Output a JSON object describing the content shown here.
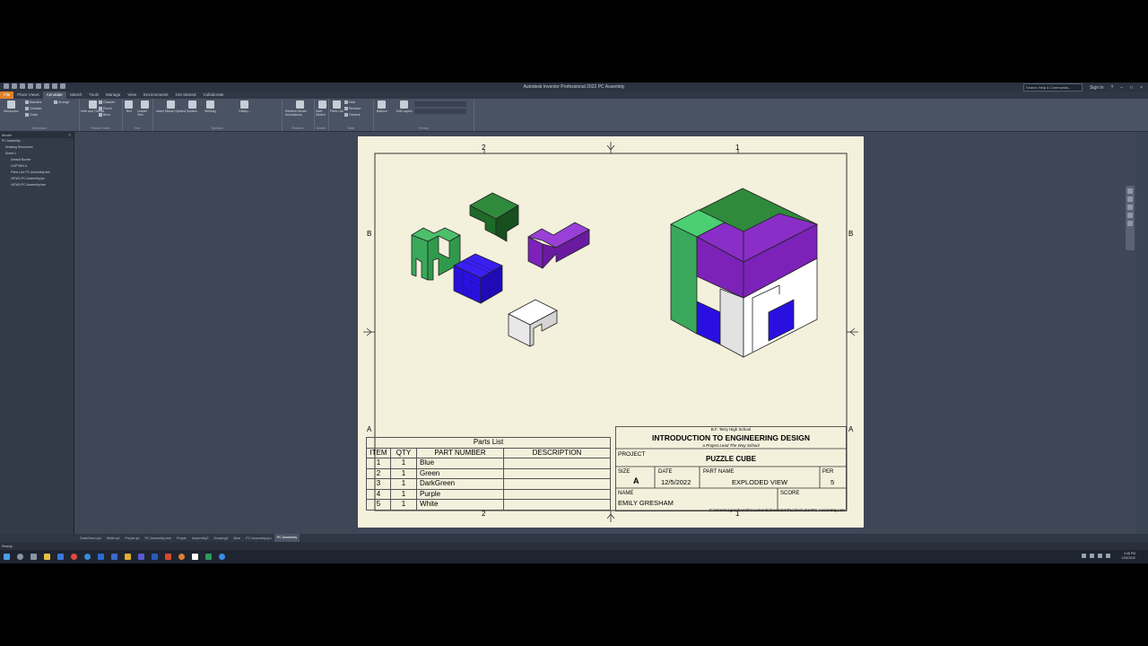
{
  "app": {
    "title": "Autodesk Inventor Professional 2022   PC Assembly",
    "search_placeholder": "Search Help & Commands...",
    "sign_in": "Sign In"
  },
  "ribbon_tabs": [
    "File",
    "Place Views",
    "Annotate",
    "Sketch",
    "Tools",
    "Manage",
    "View",
    "Environments",
    "Get Started",
    "Collaborate"
  ],
  "ribbon": {
    "dimension": {
      "label": "Dimension",
      "baseline": "Baseline",
      "ordinate": "Ordinate",
      "chain": "Chain",
      "arrange": "Arrange",
      "group": "Dimension"
    },
    "feature_notes": {
      "hole_thread": "Hole and Thread",
      "chamfer": "Chamfer",
      "punch": "Punch",
      "bend": "Bend",
      "group": "Feature Notes"
    },
    "text": {
      "text": "Text",
      "leader_text": "Leader Text",
      "group": "Text"
    },
    "symbols": {
      "sketch_symbol": "Insert Sketch Symbol",
      "surface": "Surface",
      "welding": "Welding",
      "caterpillar": "Caterp...",
      "group": "Symbols"
    },
    "retrieve": {
      "label": "Retrieve Model Annotations",
      "group": "Retrieve"
    },
    "sketch": {
      "label": "Start Sketch",
      "group": "Sketch"
    },
    "table": {
      "parts_list": "Parts List",
      "hole": "Hole",
      "revision": "Revision",
      "general": "General",
      "group": "Table"
    },
    "format": {
      "balloon": "Balloon",
      "edit_layers": "Edit Layers",
      "group": "Format"
    }
  },
  "browser": {
    "tab": "Model",
    "items": [
      "PC Assembly",
      "Drawing Resources",
      "Sheet:1",
      "Default Border",
      "CAPTAIN A",
      "Parts List: PC Assembly.iam",
      "VIEW1:PC Assembly.ipn",
      "VIEW2:PC Assembly.iam"
    ]
  },
  "sheet": {
    "zone_top": [
      "2",
      "1"
    ],
    "zone_bottom": [
      "2",
      "1"
    ],
    "zone_side": [
      "B",
      "A"
    ],
    "parts_list": {
      "title": "Parts List",
      "headers": [
        "ITEM",
        "QTY",
        "PART NUMBER",
        "DESCRIPTION"
      ],
      "rows": [
        {
          "item": "1",
          "qty": "1",
          "part": "Blue",
          "desc": ""
        },
        {
          "item": "2",
          "qty": "1",
          "part": "Green",
          "desc": ""
        },
        {
          "item": "3",
          "qty": "1",
          "part": "DarkGreen",
          "desc": ""
        },
        {
          "item": "4",
          "qty": "1",
          "part": "Purple",
          "desc": ""
        },
        {
          "item": "5",
          "qty": "1",
          "part": "White",
          "desc": ""
        }
      ]
    },
    "title_block": {
      "school": "B.F. Terry High School",
      "course": "INTRODUCTION TO ENGINEERING DESIGN",
      "tagline": "a Project Lead The Way School",
      "project_label": "PROJECT",
      "project": "PUZZLE CUBE",
      "size_label": "SIZE",
      "size": "A",
      "date_label": "DATE",
      "date": "12/5/2022",
      "part_name_label": "PART NAME",
      "part_name": "EXPLODED VIEW",
      "per_label": "PER",
      "per": "5",
      "name_label": "NAME",
      "name": "EMILY GRESHAM",
      "score_label": "SCORE",
      "path": "C:\\Users\\egresham\\Documents\\Inventor\\PuzzleCube\\PC Assembly.iam"
    }
  },
  "doc_tabs": [
    "DarkGreen.ipt",
    "White.ipt",
    "Purple.ipt",
    "PC Assembly.iam",
    "Purple",
    "Assembly2",
    "Drawing2",
    "Blue",
    "PC Assembly.ipn",
    "PC Assembly"
  ],
  "status": "Ready",
  "clock": {
    "time": "3:48 PM",
    "date": "12/5/2022"
  },
  "colors": {
    "blue": "#2a10e0",
    "green": "#3aa85a",
    "darkgreen": "#1e6a28",
    "purple": "#7c22b8",
    "white": "#f8f8f8",
    "accent": "#e0822a"
  }
}
